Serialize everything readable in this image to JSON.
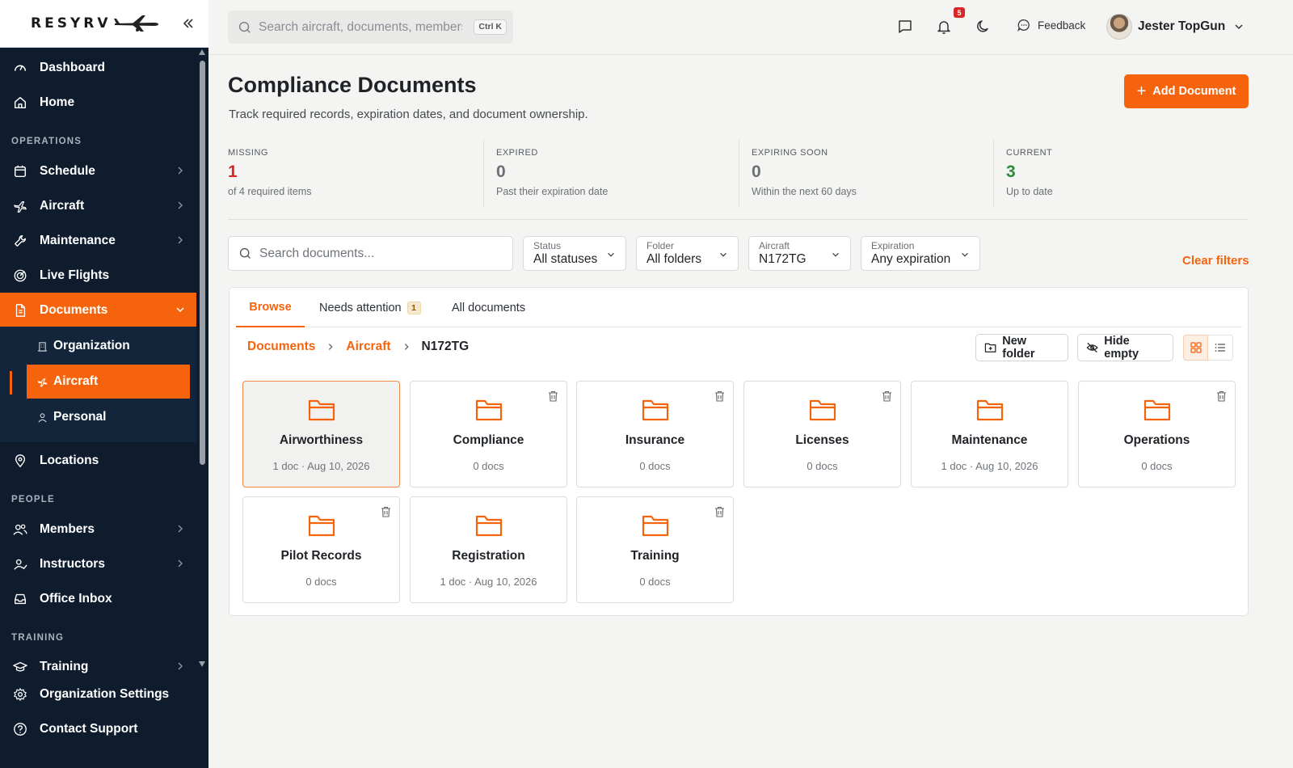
{
  "app": {
    "logo_text": "RESYRV",
    "collapse_icon": "double-chevron-left-icon"
  },
  "search": {
    "placeholder": "Search aircraft, documents, members",
    "shortcut": "Ctrl K"
  },
  "topbar": {
    "notification_count": "5",
    "feedback_label": "Feedback",
    "user_name": "Jester TopGun"
  },
  "sidebar": {
    "dashboard": "Dashboard",
    "home": "Home",
    "section_operations": "OPERATIONS",
    "schedule": "Schedule",
    "aircraft": "Aircraft",
    "maintenance": "Maintenance",
    "live_flights": "Live Flights",
    "documents": "Documents",
    "sub_organization": "Organization",
    "sub_aircraft": "Aircraft",
    "sub_personal": "Personal",
    "locations": "Locations",
    "section_people": "PEOPLE",
    "members": "Members",
    "instructors": "Instructors",
    "office_inbox": "Office Inbox",
    "section_training": "TRAINING",
    "training": "Training",
    "org_settings": "Organization Settings",
    "contact_support": "Contact Support"
  },
  "page": {
    "title": "Compliance Documents",
    "subtitle": "Track required records, expiration dates, and document ownership.",
    "add_button": "Add Document"
  },
  "stats": [
    {
      "label": "MISSING",
      "value": "1",
      "desc": "of 4 required items",
      "color": "#d62828"
    },
    {
      "label": "EXPIRED",
      "value": "0",
      "desc": "Past their expiration date",
      "color": "#6a7076"
    },
    {
      "label": "EXPIRING SOON",
      "value": "0",
      "desc": "Within the next 60 days",
      "color": "#6a7076"
    },
    {
      "label": "CURRENT",
      "value": "3",
      "desc": "Up to date",
      "color": "#2e8b3a"
    }
  ],
  "filters": {
    "search_placeholder": "Search documents...",
    "status": {
      "label": "Status",
      "value": "All statuses"
    },
    "folder": {
      "label": "Folder",
      "value": "All folders"
    },
    "aircraft": {
      "label": "Aircraft",
      "value": "N172TG"
    },
    "expiration": {
      "label": "Expiration",
      "value": "Any expiration"
    },
    "clear": "Clear filters"
  },
  "tabs": {
    "browse": "Browse",
    "needs_attention": "Needs attention",
    "needs_attention_count": "1",
    "all_documents": "All documents"
  },
  "breadcrumb": {
    "root": "Documents",
    "level1": "Aircraft",
    "current": "N172TG"
  },
  "toolbar": {
    "new_folder": "New folder",
    "hide_empty": "Hide empty"
  },
  "folders": [
    {
      "name": "Airworthiness",
      "meta": "1 doc · Aug 10, 2026"
    },
    {
      "name": "Compliance",
      "meta": "0 docs"
    },
    {
      "name": "Insurance",
      "meta": "0 docs"
    },
    {
      "name": "Licenses",
      "meta": "0 docs"
    },
    {
      "name": "Maintenance",
      "meta": "1 doc · Aug 10, 2026"
    },
    {
      "name": "Operations",
      "meta": "0 docs"
    },
    {
      "name": "Pilot Records",
      "meta": "0 docs"
    },
    {
      "name": "Registration",
      "meta": "1 doc · Aug 10, 2026"
    },
    {
      "name": "Training",
      "meta": "0 docs"
    }
  ],
  "colors": {
    "accent": "#f5640d",
    "sidebar_bg": "#0f1c2e"
  }
}
